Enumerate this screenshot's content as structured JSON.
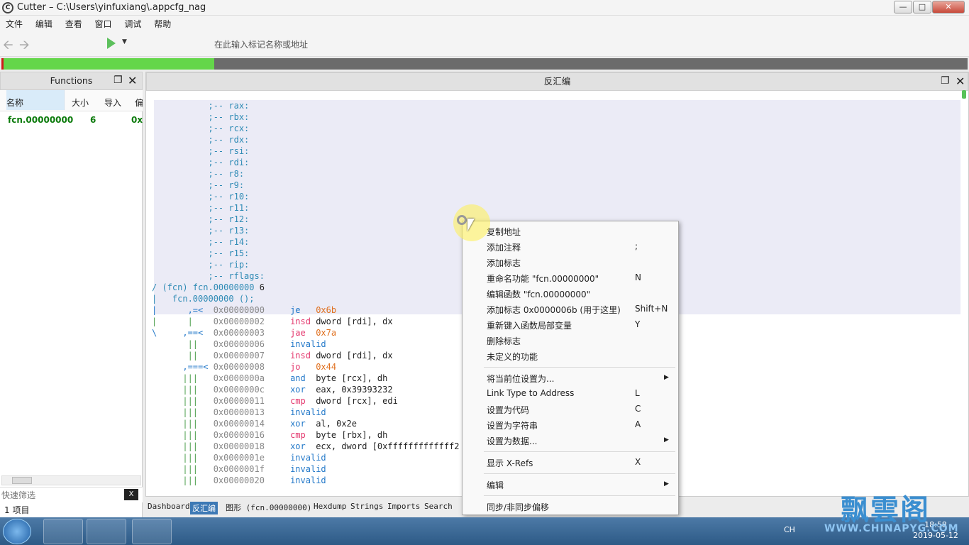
{
  "window": {
    "title": "Cutter – C:\\Users\\yinfuxiang\\.appcfg_nag",
    "app_icon_text": "C"
  },
  "menubar": [
    "文件",
    "编辑",
    "查看",
    "窗口",
    "调试",
    "帮助"
  ],
  "toolbar": {
    "search_placeholder": "在此输入标记名称或地址"
  },
  "progress": {
    "analyzed_fraction": 0.22
  },
  "functions_panel": {
    "title": "Functions",
    "columns": [
      "名称",
      "大小",
      "导入",
      "偏"
    ],
    "rows": [
      {
        "name": "fcn.00000000",
        "size": "6",
        "offset": "0x"
      }
    ],
    "filter_placeholder": "快速筛选",
    "filter_clear": "X",
    "count": "1 项目"
  },
  "disasm_panel": {
    "title": "反汇编",
    "lines": [
      {
        "arrow": "",
        "addr": "",
        "mn": "",
        "op": "",
        "cmt": ";-- rax:"
      },
      {
        "arrow": "",
        "addr": "",
        "mn": "",
        "op": "",
        "cmt": ";-- rbx:"
      },
      {
        "arrow": "",
        "addr": "",
        "mn": "",
        "op": "",
        "cmt": ";-- rcx:"
      },
      {
        "arrow": "",
        "addr": "",
        "mn": "",
        "op": "",
        "cmt": ";-- rdx:"
      },
      {
        "arrow": "",
        "addr": "",
        "mn": "",
        "op": "",
        "cmt": ";-- rsi:"
      },
      {
        "arrow": "",
        "addr": "",
        "mn": "",
        "op": "",
        "cmt": ";-- rdi:"
      },
      {
        "arrow": "",
        "addr": "",
        "mn": "",
        "op": "",
        "cmt": ";-- r8:"
      },
      {
        "arrow": "",
        "addr": "",
        "mn": "",
        "op": "",
        "cmt": ";-- r9:"
      },
      {
        "arrow": "",
        "addr": "",
        "mn": "",
        "op": "",
        "cmt": ";-- r10:"
      },
      {
        "arrow": "",
        "addr": "",
        "mn": "",
        "op": "",
        "cmt": ";-- r11:"
      },
      {
        "arrow": "",
        "addr": "",
        "mn": "",
        "op": "",
        "cmt": ";-- r12:"
      },
      {
        "arrow": "",
        "addr": "",
        "mn": "",
        "op": "",
        "cmt": ";-- r13:"
      },
      {
        "arrow": "",
        "addr": "",
        "mn": "",
        "op": "",
        "cmt": ";-- r14:"
      },
      {
        "arrow": "",
        "addr": "",
        "mn": "",
        "op": "",
        "cmt": ";-- r15:"
      },
      {
        "arrow": "",
        "addr": "",
        "mn": "",
        "op": "",
        "cmt": ";-- rip:"
      },
      {
        "arrow": "",
        "addr": "",
        "mn": "",
        "op": "",
        "cmt": ";-- rflags:"
      }
    ],
    "fcn_header": "/ (fcn) fcn.00000000 6",
    "fcn_sig": "|   fcn.00000000 ();",
    "code": [
      {
        "arrow": "|      ,=< ",
        "addr": "0x00000000",
        "mn": "je",
        "op": "0x6b",
        "mnc": "mn",
        "opc": "imm"
      },
      {
        "arrow": "|      |   ",
        "addr": "0x00000002",
        "mn": "insd",
        "op": "dword [rdi], dx",
        "mnc": "mnp",
        "opc": ""
      },
      {
        "arrow": "\\     ,==< ",
        "addr": "0x00000003",
        "mn": "jae",
        "op": "0x7a",
        "mnc": "mnp",
        "opc": "imm"
      },
      {
        "arrow": "       ||  ",
        "addr": "0x00000006",
        "mn": "invalid",
        "op": "",
        "mnc": "mn",
        "opc": ""
      },
      {
        "arrow": "       ||  ",
        "addr": "0x00000007",
        "mn": "insd",
        "op": "dword [rdi], dx",
        "mnc": "mnp",
        "opc": ""
      },
      {
        "arrow": "      ,===< ",
        "addr": "0x00000008",
        "mn": "jo",
        "op": "0x44",
        "mnc": "mnp",
        "opc": "imm"
      },
      {
        "arrow": "      |||  ",
        "addr": "0x0000000a",
        "mn": "and",
        "op": "byte [rcx], dh",
        "mnc": "mn",
        "opc": ""
      },
      {
        "arrow": "      |||  ",
        "addr": "0x0000000c",
        "mn": "xor",
        "op": "eax, 0x39393232",
        "mnc": "mn",
        "opc": ""
      },
      {
        "arrow": "      |||  ",
        "addr": "0x00000011",
        "mn": "cmp",
        "op": "dword [rcx], edi",
        "mnc": "mnp",
        "opc": ""
      },
      {
        "arrow": "      |||  ",
        "addr": "0x00000013",
        "mn": "invalid",
        "op": "",
        "mnc": "mn",
        "opc": ""
      },
      {
        "arrow": "      |||  ",
        "addr": "0x00000014",
        "mn": "xor",
        "op": "al, 0x2e",
        "mnc": "mn",
        "opc": ""
      },
      {
        "arrow": "      |||  ",
        "addr": "0x00000016",
        "mn": "cmp",
        "op": "byte [rbx], dh",
        "mnc": "mnp",
        "opc": ""
      },
      {
        "arrow": "      |||  ",
        "addr": "0x00000018",
        "mn": "xor",
        "op": "ecx, dword [0xfffffffffffff2",
        "mnc": "mn",
        "opc": ""
      },
      {
        "arrow": "      |||  ",
        "addr": "0x0000001e",
        "mn": "invalid",
        "op": "",
        "mnc": "mn",
        "opc": ""
      },
      {
        "arrow": "      |||  ",
        "addr": "0x0000001f",
        "mn": "invalid",
        "op": "",
        "mnc": "mn",
        "opc": ""
      },
      {
        "arrow": "      |||  ",
        "addr": "0x00000020",
        "mn": "invalid",
        "op": "",
        "mnc": "mn",
        "opc": ""
      }
    ]
  },
  "bottom_tabs": [
    "Dashboard",
    "反汇编",
    "图形 (fcn.00000000)",
    "Hexdump",
    "Strings",
    "Imports",
    "Search"
  ],
  "context_menu": {
    "items": [
      {
        "label": "复制地址",
        "shortcut": ""
      },
      {
        "label": "添加注释",
        "shortcut": ";"
      },
      {
        "label": "添加标志",
        "shortcut": ""
      },
      {
        "label": "重命名功能 \"fcn.00000000\"",
        "shortcut": "N"
      },
      {
        "label": "编辑函数 \"fcn.00000000\"",
        "shortcut": ""
      },
      {
        "label": "添加标志 0x0000006b (用于这里)",
        "shortcut": "Shift+N"
      },
      {
        "label": "重新键入函数局部变量",
        "shortcut": "Y"
      },
      {
        "label": "删除标志",
        "shortcut": ""
      },
      {
        "label": "未定义的功能",
        "shortcut": ""
      },
      {
        "label": "将当前位设置为...",
        "shortcut": "",
        "submenu": true
      },
      {
        "label": "Link Type to Address",
        "shortcut": "L"
      },
      {
        "label": "设置为代码",
        "shortcut": "C"
      },
      {
        "label": "设置为字符串",
        "shortcut": "A"
      },
      {
        "label": "设置为数据...",
        "shortcut": "",
        "submenu": true
      },
      {
        "label": "显示 X-Refs",
        "shortcut": "X"
      },
      {
        "label": "编辑",
        "shortcut": "",
        "submenu": true
      },
      {
        "label": "同步/非同步偏移",
        "shortcut": ""
      }
    ]
  },
  "taskbar": {
    "tray_lang": "CH",
    "clock_time": "18:58",
    "clock_date": "2019-05-12"
  },
  "watermark": {
    "text": "飘雲阁",
    "url": "WWW.CHINAPYG.COM"
  }
}
